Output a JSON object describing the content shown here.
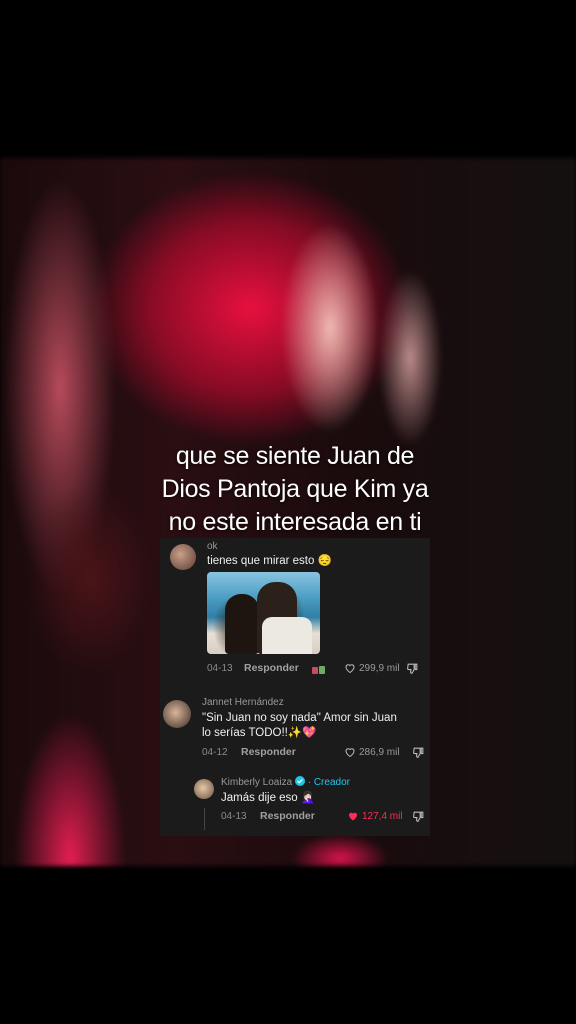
{
  "caption": {
    "line1": "que se siente Juan de",
    "line2": "Dios Pantoja que Kim ya",
    "line3": "no este interesada en ti"
  },
  "comments": [
    {
      "username": "ok",
      "text": "tienes que mirar esto 😔",
      "date": "04-13",
      "reply_label": "Responder",
      "likes": "299,9 mil"
    },
    {
      "username": "Jannet Hernández",
      "text_line1": "\"Sin Juan no soy nada\" Amor sin Juan",
      "text_line2": "lo serías TODO!!✨💖",
      "date": "04-12",
      "reply_label": "Responder",
      "likes": "286,9 mil"
    },
    {
      "username": "Kimberly Loaiza",
      "badge": "· Creador",
      "text": "Jamás dije eso 🤦🏻‍♀️",
      "date": "04-13",
      "reply_label": "Responder",
      "likes": "127,4 mil"
    }
  ],
  "colors": {
    "creator_badge": "#22c5e8",
    "liked_heart": "#fe2c55",
    "card_bg": "#1b1b1b"
  }
}
